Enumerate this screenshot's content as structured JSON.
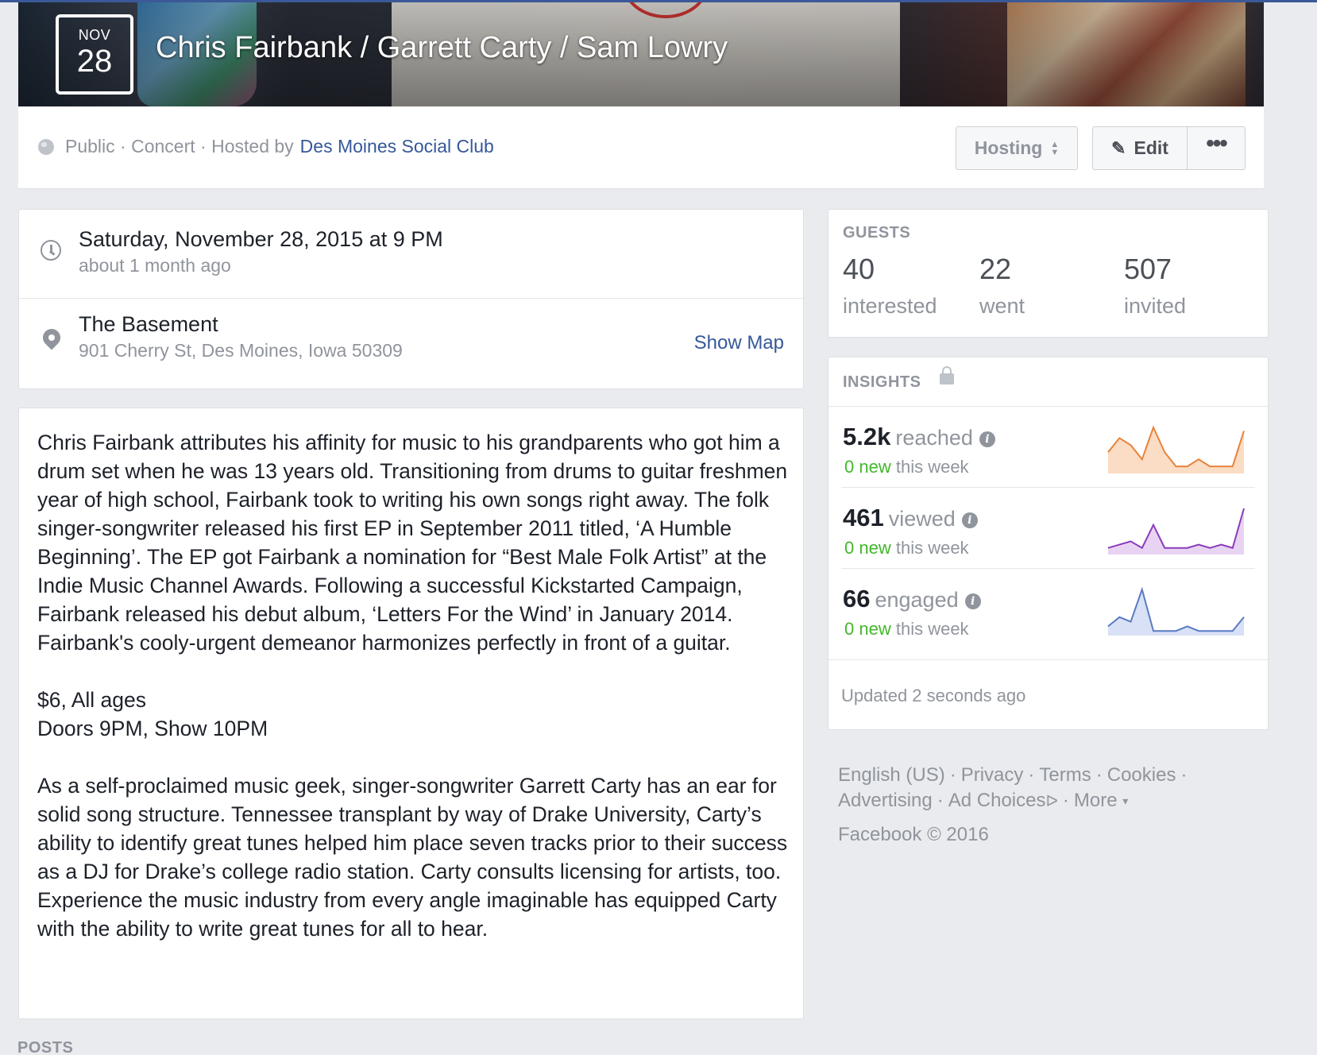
{
  "event": {
    "month": "NOV",
    "day": "28",
    "title": "Chris Fairbank / Garrett Carty / Sam Lowry",
    "privacy": "Public",
    "category": "Concert",
    "hosted_by_prefix": "Hosted by",
    "host": "Des Moines Social Club"
  },
  "actions": {
    "hosting": "Hosting",
    "edit": "Edit",
    "more": "•••"
  },
  "when": {
    "datetime": "Saturday, November 28, 2015 at 9 PM",
    "relative": "about 1 month ago"
  },
  "where": {
    "venue": "The Basement",
    "address": "901 Cherry St, Des Moines, Iowa 50309",
    "show_map": "Show Map"
  },
  "description": {
    "para1": "Chris Fairbank attributes his affinity for music to his grandparents who got him a drum set when he was 13 years old. Transitioning from drums to guitar freshmen year of high school, Fairbank took to writing his own songs right away. The folk singer-songwriter released his first EP in September 2011 titled, ‘A Humble Beginning’. The EP got Fairbank a nomination for “Best Male Folk Artist” at the Indie Music Channel Awards. Following a successful Kickstarted Campaign, Fairbank released his debut album, ‘Letters For the Wind’ in January 2014. Fairbank's cooly-urgent demeanor harmonizes perfectly in front of a guitar.",
    "price": "$6, All ages",
    "doors": "Doors 9PM, Show 10PM",
    "para3": "As a self-proclaimed music geek, singer-songwriter Garrett Carty has an ear for solid song structure. Tennessee transplant by way of Drake University, Carty’s ability to identify great tunes helped him place seven tracks prior to their success as a DJ for Drake’s college radio station. Carty consults licensing for artists, too. Experience the music industry from every angle imaginable has equipped Carty with the ability to write great tunes for all to hear."
  },
  "posts_label": "POSTS",
  "guests": {
    "label": "GUESTS",
    "interested_count": "40",
    "interested_label": "interested",
    "went_count": "22",
    "went_label": "went",
    "invited_count": "507",
    "invited_label": "invited"
  },
  "insights": {
    "label": "INSIGHTS",
    "metrics": [
      {
        "value": "5.2k",
        "word": "reached",
        "new_count": "0 new",
        "new_suffix": "this week",
        "color": "#e8823a",
        "fill": "#fbdcc4",
        "spark": [
          6,
          10,
          8,
          4,
          13,
          6,
          2,
          2,
          4,
          2,
          2,
          2,
          12
        ]
      },
      {
        "value": "461",
        "word": "viewed",
        "new_count": "0 new",
        "new_suffix": "this week",
        "color": "#8a3ab9",
        "fill": "#e8d3f3",
        "spark": [
          2,
          3,
          4,
          2,
          9,
          2,
          2,
          2,
          3,
          2,
          3,
          2,
          14
        ]
      },
      {
        "value": "66",
        "word": "engaged",
        "new_count": "0 new",
        "new_suffix": "this week",
        "color": "#5b7bc4",
        "fill": "#d8e1f5",
        "spark": [
          2,
          4,
          3,
          10,
          1,
          1,
          1,
          2,
          1,
          1,
          1,
          1,
          4
        ]
      }
    ],
    "updated": "Updated 2 seconds ago"
  },
  "footer": {
    "links": [
      "English (US)",
      "Privacy",
      "Terms",
      "Cookies",
      "Advertising",
      "Ad Choices"
    ],
    "more": "More",
    "copyright": "Facebook © 2016"
  }
}
